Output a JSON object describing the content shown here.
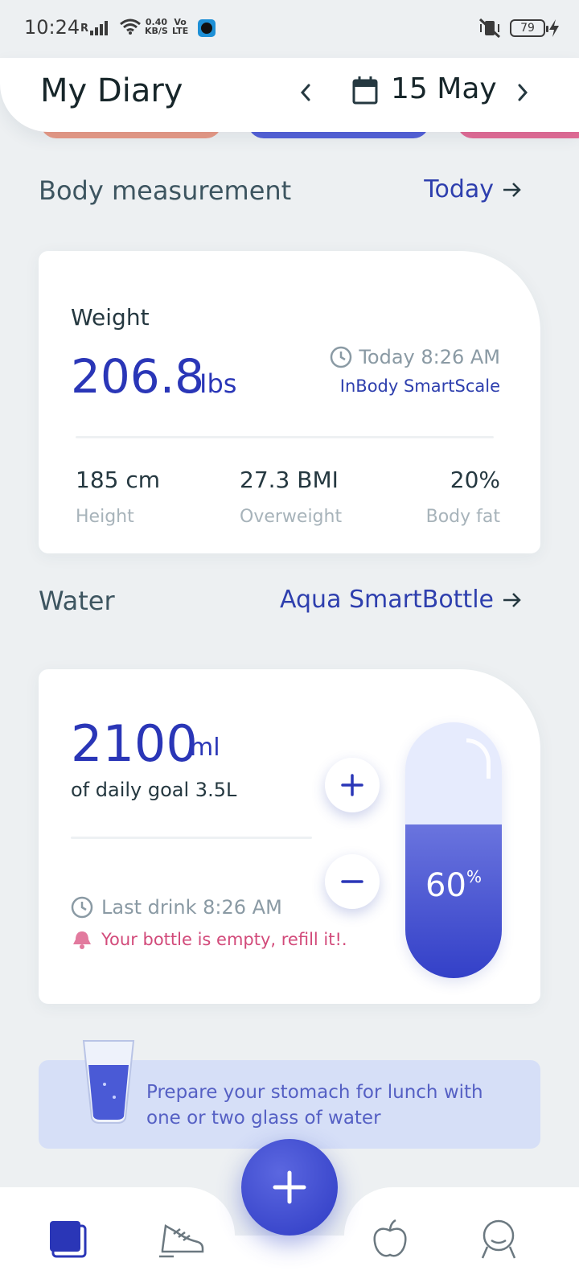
{
  "status_bar": {
    "time": "10:24",
    "signal_label": "R",
    "net_speed_value": "0.40",
    "net_speed_unit": "KB/S",
    "volte_top": "Vo",
    "volte_bottom": "LTE",
    "battery": "79"
  },
  "header": {
    "title": "My Diary",
    "date": "15 May"
  },
  "body_measurement": {
    "section_title": "Body measurement",
    "link_label": "Today",
    "weight_label": "Weight",
    "weight_value": "206.8",
    "weight_unit": "Ibs",
    "measured_time": "Today 8:26 AM",
    "source": "InBody SmartScale",
    "stats": [
      {
        "value": "185 cm",
        "label": "Height"
      },
      {
        "value": "27.3 BMI",
        "label": "Overweight"
      },
      {
        "value": "20%",
        "label": "Body fat"
      }
    ]
  },
  "water": {
    "section_title": "Water",
    "link_label": "Aqua SmartBottle",
    "amount": "2100",
    "unit": "ml",
    "goal_text": "of daily goal 3.5L",
    "last_drink": "Last drink 8:26 AM",
    "alert": "Your bottle is empty, refill it!.",
    "bottle_percent_value": "60",
    "bottle_percent_sign": "%",
    "bottle_fill_fraction": 0.6
  },
  "tip": {
    "text": "Prepare your stomach for lunch with one or two glass of water"
  },
  "colors": {
    "accent": "#2a36b7",
    "background": "#edf0f2",
    "alert": "#d24a7a"
  },
  "bottom_nav": {
    "tabs": [
      "diary-icon",
      "sneaker-icon",
      "apple-icon",
      "profile-icon"
    ],
    "fab_icon": "plus-icon"
  }
}
